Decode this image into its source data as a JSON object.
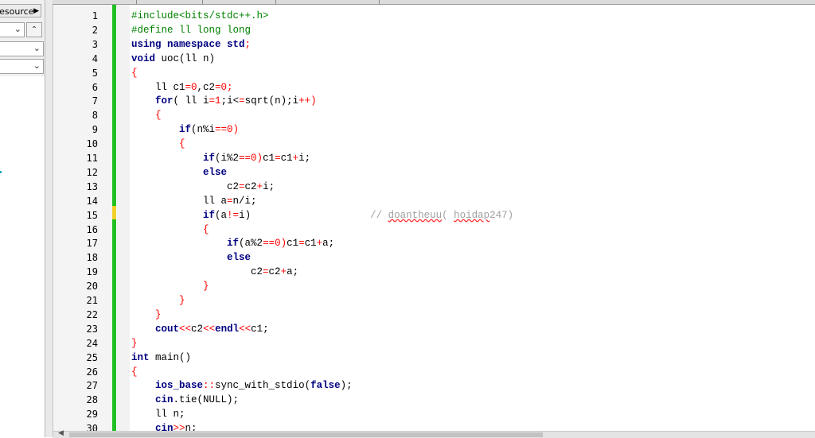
{
  "left_panel": {
    "resource_tab_label": "Resource",
    "combo_chevron": "chevron-down-icon",
    "up_button": "chevron-up-icon"
  },
  "line_numbers": [
    "1",
    "2",
    "3",
    "4",
    "5",
    "6",
    "7",
    "8",
    "9",
    "10",
    "11",
    "12",
    "13",
    "14",
    "15",
    "16",
    "17",
    "18",
    "19",
    "20",
    "21",
    "22",
    "23",
    "24",
    "25",
    "26",
    "27",
    "28",
    "29",
    "30"
  ],
  "code_lines": [
    [
      {
        "t": "#include<bits/stdc++.h>",
        "c": "pre"
      }
    ],
    [
      {
        "t": "#define ll long long",
        "c": "pre"
      }
    ],
    [
      {
        "t": "using namespace std",
        "c": "kw"
      },
      {
        "t": ";",
        "c": "op"
      }
    ],
    [
      {
        "t": "void",
        "c": "kw"
      },
      {
        "t": " uoc(ll n)",
        "c": ""
      }
    ],
    [
      {
        "t": "{",
        "c": "op"
      }
    ],
    [
      {
        "t": "    ll c1",
        "c": ""
      },
      {
        "t": "=0",
        "c": "num"
      },
      {
        "t": ",c2",
        "c": ""
      },
      {
        "t": "=0;",
        "c": "num"
      }
    ],
    [
      {
        "t": "    ",
        "c": ""
      },
      {
        "t": "for",
        "c": "kw"
      },
      {
        "t": "( ll i",
        "c": ""
      },
      {
        "t": "=1",
        "c": "num"
      },
      {
        "t": ";i<",
        "c": ""
      },
      {
        "t": "=",
        "c": "op"
      },
      {
        "t": "sqrt(n);i",
        "c": ""
      },
      {
        "t": "++)",
        "c": "op"
      }
    ],
    [
      {
        "t": "    {",
        "c": "op"
      }
    ],
    [
      {
        "t": "        ",
        "c": ""
      },
      {
        "t": "if",
        "c": "kw"
      },
      {
        "t": "(n%i",
        "c": ""
      },
      {
        "t": "==0)",
        "c": "num"
      }
    ],
    [
      {
        "t": "        {",
        "c": "op"
      }
    ],
    [
      {
        "t": "            ",
        "c": ""
      },
      {
        "t": "if",
        "c": "kw"
      },
      {
        "t": "(i%2",
        "c": ""
      },
      {
        "t": "==0)",
        "c": "num"
      },
      {
        "t": "c1",
        "c": ""
      },
      {
        "t": "=",
        "c": "op"
      },
      {
        "t": "c1",
        "c": ""
      },
      {
        "t": "+",
        "c": "op"
      },
      {
        "t": "i;",
        "c": ""
      }
    ],
    [
      {
        "t": "            ",
        "c": ""
      },
      {
        "t": "else",
        "c": "kw"
      }
    ],
    [
      {
        "t": "                c2",
        "c": ""
      },
      {
        "t": "=",
        "c": "op"
      },
      {
        "t": "c2",
        "c": ""
      },
      {
        "t": "+",
        "c": "op"
      },
      {
        "t": "i;",
        "c": ""
      }
    ],
    [
      {
        "t": "            ll a",
        "c": ""
      },
      {
        "t": "=",
        "c": "op"
      },
      {
        "t": "n/i;",
        "c": ""
      }
    ],
    [
      {
        "t": "            ",
        "c": ""
      },
      {
        "t": "if",
        "c": "kw"
      },
      {
        "t": "(a",
        "c": ""
      },
      {
        "t": "!=",
        "c": "op"
      },
      {
        "t": "i)",
        "c": ""
      },
      {
        "t": "                    // ",
        "c": "cmt"
      },
      {
        "t": "doantheuu",
        "c": "cmt squig"
      },
      {
        "t": "( ",
        "c": "cmt"
      },
      {
        "t": "hoidap",
        "c": "cmt squig"
      },
      {
        "t": "247)",
        "c": "cmt"
      }
    ],
    [
      {
        "t": "            {",
        "c": "op"
      }
    ],
    [
      {
        "t": "                ",
        "c": ""
      },
      {
        "t": "if",
        "c": "kw"
      },
      {
        "t": "(a%2",
        "c": ""
      },
      {
        "t": "==0)",
        "c": "num"
      },
      {
        "t": "c1",
        "c": ""
      },
      {
        "t": "=",
        "c": "op"
      },
      {
        "t": "c1",
        "c": ""
      },
      {
        "t": "+",
        "c": "op"
      },
      {
        "t": "a;",
        "c": ""
      }
    ],
    [
      {
        "t": "                ",
        "c": ""
      },
      {
        "t": "else",
        "c": "kw"
      }
    ],
    [
      {
        "t": "                    c2",
        "c": ""
      },
      {
        "t": "=",
        "c": "op"
      },
      {
        "t": "c2",
        "c": ""
      },
      {
        "t": "+",
        "c": "op"
      },
      {
        "t": "a;",
        "c": ""
      }
    ],
    [
      {
        "t": "            }",
        "c": "op"
      }
    ],
    [
      {
        "t": "        }",
        "c": "op"
      }
    ],
    [
      {
        "t": "    }",
        "c": "op"
      }
    ],
    [
      {
        "t": "    ",
        "c": ""
      },
      {
        "t": "cout",
        "c": "kw"
      },
      {
        "t": "<<",
        "c": "op"
      },
      {
        "t": "c2",
        "c": ""
      },
      {
        "t": "<<",
        "c": "op"
      },
      {
        "t": "endl",
        "c": "kw"
      },
      {
        "t": "<<",
        "c": "op"
      },
      {
        "t": "c1;",
        "c": ""
      }
    ],
    [
      {
        "t": "}",
        "c": "op"
      }
    ],
    [
      {
        "t": "int",
        "c": "kw"
      },
      {
        "t": " main()",
        "c": ""
      }
    ],
    [
      {
        "t": "{",
        "c": "op"
      }
    ],
    [
      {
        "t": "    ",
        "c": ""
      },
      {
        "t": "ios_base",
        "c": "kw"
      },
      {
        "t": "::",
        "c": "op"
      },
      {
        "t": "sync_with_stdio(",
        "c": ""
      },
      {
        "t": "false",
        "c": "kw"
      },
      {
        "t": ");",
        "c": ""
      }
    ],
    [
      {
        "t": "    ",
        "c": ""
      },
      {
        "t": "cin",
        "c": "kw"
      },
      {
        "t": ".tie(NULL);",
        "c": ""
      }
    ],
    [
      {
        "t": "    ll n;",
        "c": ""
      }
    ],
    [
      {
        "t": "    ",
        "c": ""
      },
      {
        "t": "cin",
        "c": "kw"
      },
      {
        "t": ">>",
        "c": "op"
      },
      {
        "t": "n;",
        "c": ""
      }
    ]
  ],
  "colors": {
    "change_marker": "#22c022",
    "current_line_marker": "#f2d12a",
    "keyword": "#000080",
    "preprocessor": "#008000",
    "number_operator": "#ff0000",
    "comment": "#a0a0a0"
  }
}
